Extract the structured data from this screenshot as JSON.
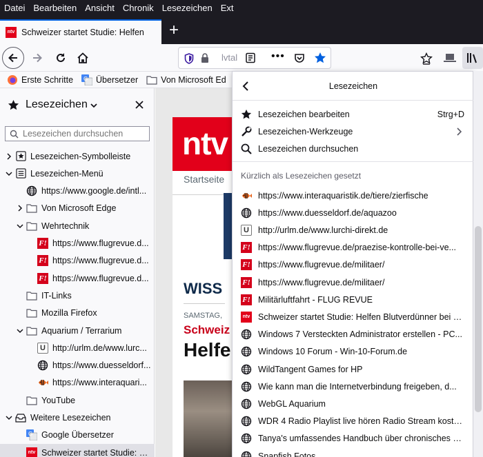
{
  "menubar": {
    "items": [
      "Datei",
      "Bearbeiten",
      "Ansicht",
      "Chronik",
      "Lesezeichen",
      "Ext"
    ]
  },
  "tab": {
    "title": "Schweizer startet Studie: Helfen",
    "favicon": "ntv"
  },
  "urlbar": {
    "text": "lvtal"
  },
  "bookmarks_toolbar": {
    "items": [
      "Erste Schritte",
      "Übersetzer",
      "Von Microsoft Ed"
    ]
  },
  "sidebar": {
    "title": "Lesezeichen",
    "search_placeholder": "Lesezeichen durchsuchen",
    "tree": [
      {
        "label": "Lesezeichen-Symbolleiste"
      },
      {
        "label": "Lesezeichen-Menü"
      },
      {
        "label": "https://www.google.de/intl..."
      },
      {
        "label": "Von Microsoft Edge"
      },
      {
        "label": "Wehrtechnik"
      },
      {
        "label": "https://www.flugrevue.d..."
      },
      {
        "label": "https://www.flugrevue.d..."
      },
      {
        "label": "https://www.flugrevue.d..."
      },
      {
        "label": "IT-Links"
      },
      {
        "label": "Mozilla Firefox"
      },
      {
        "label": "Aquarium / Terrarium"
      },
      {
        "label": "http://urlm.de/www.lurc..."
      },
      {
        "label": "https://www.duesseldorf..."
      },
      {
        "label": "https://www.interaquari..."
      },
      {
        "label": "YouTube"
      },
      {
        "label": "Weitere Lesezeichen"
      },
      {
        "label": "Google Übersetzer"
      },
      {
        "label": "Schweizer startet Studie: H..."
      }
    ]
  },
  "page": {
    "logo": "ntv",
    "nav": "Startseite",
    "section": "WISS",
    "date": "SAMSTAG,",
    "kicker": "Schweiz",
    "headline": "Helfe"
  },
  "panel": {
    "title": "Lesezeichen",
    "actions": [
      {
        "label": "Lesezeichen bearbeiten",
        "shortcut": "Strg+D"
      },
      {
        "label": "Lesezeichen-Werkzeuge"
      },
      {
        "label": "Lesezeichen durchsuchen"
      }
    ],
    "recent_header": "Kürzlich als Lesezeichen gesetzt",
    "recent": [
      {
        "label": "https://www.interaquaristik.de/tiere/zierfische",
        "icon": "fish"
      },
      {
        "label": "https://www.duesseldorf.de/aquazoo",
        "icon": "globe"
      },
      {
        "label": "http://urlm.de/www.lurchi-direkt.de",
        "icon": "u"
      },
      {
        "label": "https://www.flugrevue.de/praezise-kontrolle-bei-ve...",
        "icon": "flugrevue"
      },
      {
        "label": "https://www.flugrevue.de/militaer/",
        "icon": "flugrevue"
      },
      {
        "label": "https://www.flugrevue.de/militaer/",
        "icon": "flugrevue"
      },
      {
        "label": "Militärluftfahrt - FLUG REVUE",
        "icon": "flugrevue"
      },
      {
        "label": "Schweizer startet Studie: Helfen Blutverdünner bei C...",
        "icon": "ntv"
      },
      {
        "label": "Windows 7 Versteckten Administrator erstellen - PC...",
        "icon": "globe"
      },
      {
        "label": "Windows 10 Forum - Win-10-Forum.de",
        "icon": "globe"
      },
      {
        "label": "WildTangent Games for HP",
        "icon": "globe"
      },
      {
        "label": "Wie kann man die Internetverbindung  freigeben, d...",
        "icon": "globe"
      },
      {
        "label": "WebGL Aquarium",
        "icon": "globe"
      },
      {
        "label": "WDR 4 Radio Playlist live hören Radio Stream koste...",
        "icon": "globe"
      },
      {
        "label": "Tanya's umfassendes Handbuch über chronisches Ni...",
        "icon": "globe"
      },
      {
        "label": "Snapfish Fotos",
        "icon": "globe"
      }
    ]
  }
}
